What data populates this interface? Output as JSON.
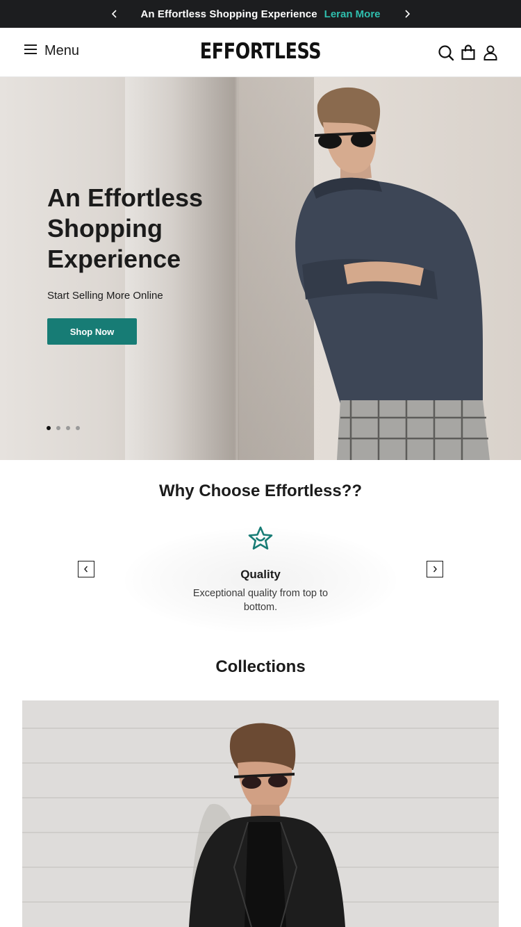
{
  "announcement": {
    "text": "An Effortless Shopping Experience",
    "link": "Leran More",
    "prev_icon": "chevron-left-icon",
    "next_icon": "chevron-right-icon"
  },
  "header": {
    "menu_label": "Menu",
    "logo": "EFFORTLESS",
    "icons": [
      "search-icon",
      "cart-bag-icon",
      "account-icon"
    ]
  },
  "hero": {
    "title_lines": [
      "An Effortless",
      "Shopping",
      "Experience"
    ],
    "subtitle": "Start Selling More Online",
    "button": "Shop Now",
    "slides": 4,
    "active_slide": 1
  },
  "why": {
    "title": "Why Choose Effortless??",
    "feature": {
      "icon": "star-smile-icon",
      "title": "Quality",
      "description": "Exceptional quality from top to bottom."
    }
  },
  "collections": {
    "title": "Collections"
  },
  "colors": {
    "announce_bg": "#1c1d1f",
    "link_accent": "#2fbfae",
    "primary_button": "#177c75"
  }
}
